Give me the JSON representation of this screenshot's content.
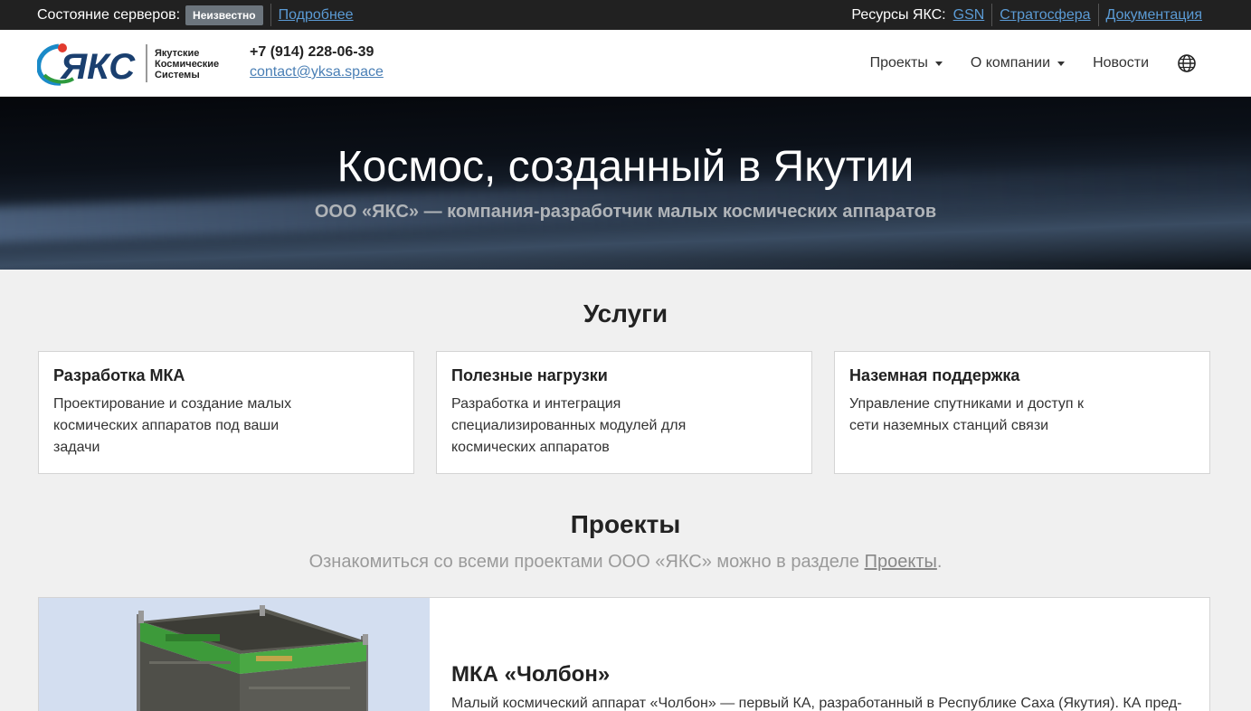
{
  "topbar": {
    "status_label": "Состояние серверов:",
    "status_value": "Неизвестно",
    "details_link": "Подробнее",
    "resources_label": "Ресурсы ЯКС:",
    "resources": [
      {
        "label": "GSN"
      },
      {
        "label": "Стратосфера"
      },
      {
        "label": "Документация"
      }
    ]
  },
  "header": {
    "logo_text": "ЯКС",
    "logo_words": [
      "Якутские",
      "Космические",
      "Системы"
    ],
    "phone": "+7 (914) 228-06-39",
    "email": "contact@yksa.space",
    "nav": [
      {
        "label": "Проекты",
        "dropdown": true
      },
      {
        "label": "О компании",
        "dropdown": true
      },
      {
        "label": "Новости",
        "dropdown": false
      }
    ],
    "language_icon": "globe-icon"
  },
  "hero": {
    "title": "Космос, созданный в Якутии",
    "subtitle": "ООО «ЯКС» — компания-разработчик малых космических аппаратов"
  },
  "services": {
    "title": "Услуги",
    "items": [
      {
        "title": "Разработка МКА",
        "text": "Проектирование и создание малых космических аппаратов под ваши задачи"
      },
      {
        "title": "Полезные нагрузки",
        "text": "Разработка и интеграция специализированных модулей для космических аппаратов"
      },
      {
        "title": "Наземная поддержка",
        "text": "Управление спутниками и доступ к сети наземных станций связи"
      }
    ]
  },
  "projects": {
    "title": "Проекты",
    "subtitle_prefix": "Ознакомиться со всеми проектами ООО «ЯКС» можно в разделе ",
    "subtitle_link": "Проекты",
    "subtitle_suffix": ".",
    "items": [
      {
        "name": "МКА «Чолбон»",
        "description": "Малый космический аппарат «Чолбон» — первый КА, разработанный в Республике Саха (Якутия). КА пред-"
      }
    ]
  },
  "colors": {
    "topbar_bg": "#212121",
    "link": "#4a7fb5",
    "badge": "#6c757d",
    "page_bg": "#f0f0f0"
  }
}
